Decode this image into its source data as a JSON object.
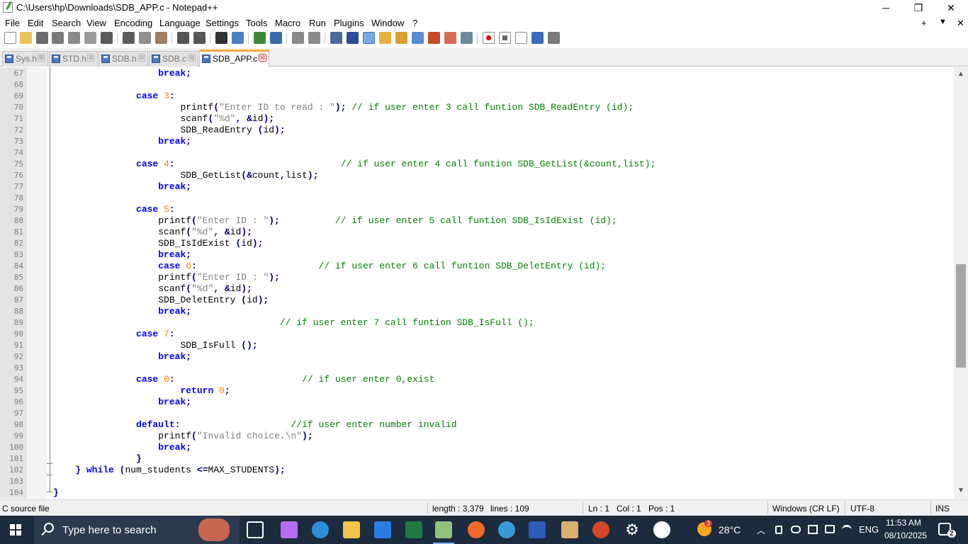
{
  "window": {
    "title": "C:\\Users\\hp\\Downloads\\SDB_APP.c - Notepad++",
    "minimize": "─",
    "maximize": "❐",
    "close": "✕"
  },
  "menu": [
    "File",
    "Edit",
    "Search",
    "View",
    "Encoding",
    "Language",
    "Settings",
    "Tools",
    "Macro",
    "Run",
    "Plugins",
    "Window",
    "?"
  ],
  "menu_right": {
    "plus": "+",
    "dropdown": "▼",
    "close": "✕"
  },
  "tabs": [
    {
      "label": "Sys.h"
    },
    {
      "label": "STD.h"
    },
    {
      "label": "SDB.h"
    },
    {
      "label": "SDB.c"
    },
    {
      "label": "SDB_APP.c"
    }
  ],
  "tab_close": "⊠",
  "editor": {
    "line_numbers": [
      "67",
      "68",
      "69",
      "70",
      "71",
      "72",
      "73",
      "74",
      "75",
      "76",
      "77",
      "78",
      "79",
      "80",
      "81",
      "82",
      "83",
      "84",
      "85",
      "86",
      "87",
      "88",
      "89",
      "90",
      "91",
      "92",
      "93",
      "94",
      "95",
      "96",
      "97",
      "98",
      "99",
      "100",
      "101",
      "102",
      "103",
      "104"
    ]
  },
  "status": {
    "filetype": "C source file",
    "length": "length : 3,379",
    "lines": "lines : 109",
    "ln": "Ln : 1",
    "col": "Col : 1",
    "pos": "Pos : 1",
    "eol": "Windows (CR LF)",
    "encoding": "UTF-8",
    "mode": "INS"
  },
  "taskbar": {
    "search_placeholder": "Type here to search",
    "weather": "28°C",
    "weather_badge": "3",
    "lang": "ENG",
    "time": "11:53 AM",
    "date": "08/10/2025",
    "notif_count": "2"
  },
  "colors": {
    "keyword": "#0000ff",
    "number": "#ff8000",
    "string": "#808080",
    "comment": "#008000",
    "active_tab_accent": "#fba93a",
    "taskbar": "#1c2b3e"
  }
}
